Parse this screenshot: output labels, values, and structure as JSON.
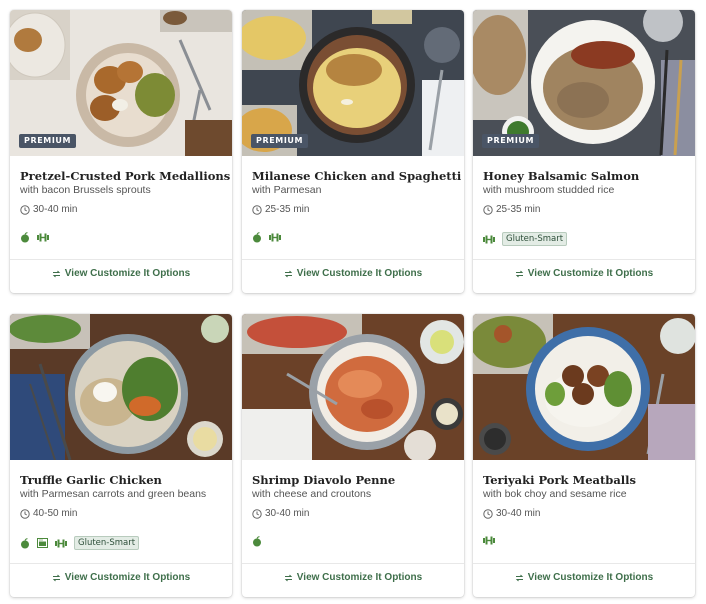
{
  "colors": {
    "brand_green": "#3f6f4b",
    "badge_bg": "#4a5566",
    "tag_bg": "#e3ece5"
  },
  "cards": [
    {
      "badge": "PREMIUM",
      "title": "Pretzel-Crusted Pork Medallions",
      "subtitle": "with bacon Brussels sprouts",
      "time": "30-40 min",
      "icons": [
        "apple-icon",
        "dumbbell-icon"
      ],
      "tag_label": "",
      "cta": "View Customize It Options"
    },
    {
      "badge": "PREMIUM",
      "title": "Milanese Chicken and Spaghetti",
      "subtitle": "with Parmesan",
      "time": "25-35 min",
      "icons": [
        "apple-icon",
        "dumbbell-icon"
      ],
      "tag_label": "",
      "cta": "View Customize It Options"
    },
    {
      "badge": "PREMIUM",
      "title": "Honey Balsamic Salmon",
      "subtitle": "with mushroom studded rice",
      "time": "25-35 min",
      "icons": [
        "dumbbell-icon"
      ],
      "tag_label": "Gluten-Smart",
      "cta": "View Customize It Options"
    },
    {
      "badge": "",
      "title": "Truffle Garlic Chicken",
      "subtitle": "with Parmesan carrots and green beans",
      "time": "40-50 min",
      "icons": [
        "apple-icon",
        "oven-icon",
        "dumbbell-icon"
      ],
      "tag_label": "Gluten-Smart",
      "cta": "View Customize It Options"
    },
    {
      "badge": "",
      "title": "Shrimp Diavolo Penne",
      "subtitle": "with cheese and croutons",
      "time": "30-40 min",
      "icons": [
        "apple-icon"
      ],
      "tag_label": "",
      "cta": "View Customize It Options"
    },
    {
      "badge": "",
      "title": "Teriyaki Pork Meatballs",
      "subtitle": "with bok choy and sesame rice",
      "time": "30-40 min",
      "icons": [
        "dumbbell-icon"
      ],
      "tag_label": "",
      "cta": "View Customize It Options"
    }
  ]
}
